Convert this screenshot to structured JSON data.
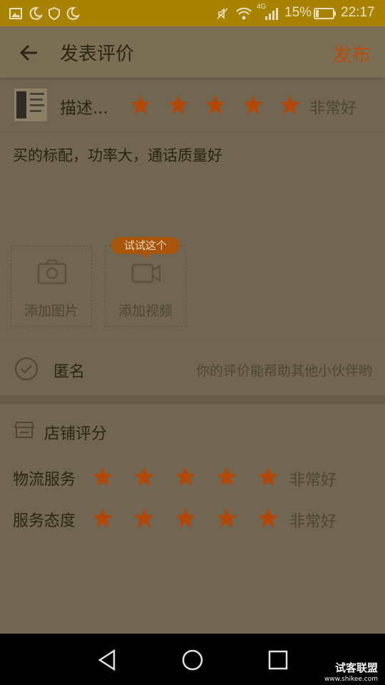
{
  "status_bar": {
    "network": "4G",
    "battery": "15%",
    "time": "22:17"
  },
  "app_bar": {
    "title": "发表评价",
    "publish_label": "发布"
  },
  "product_rating": {
    "label": "描述...",
    "stars": 5,
    "max_stars": 5,
    "rating_text": "非常好"
  },
  "review": {
    "text": "买的标配，功率大，通话质量好"
  },
  "media": {
    "add_photo_label": "添加图片",
    "add_video_label": "添加视频",
    "video_tip": "试试这个"
  },
  "anonymous": {
    "label": "匿名",
    "hint": "你的评价能帮助其他小伙伴哟"
  },
  "shop": {
    "title": "店铺评分",
    "ratings": [
      {
        "label": "物流服务",
        "stars": 5,
        "max_stars": 5,
        "rating_text": "非常好"
      },
      {
        "label": "服务态度",
        "stars": 5,
        "max_stars": 5,
        "rating_text": "非常好"
      }
    ]
  },
  "watermark": {
    "name": "试客联盟",
    "url": "www.shikee.com"
  },
  "colors": {
    "accent": "#b94d09",
    "star": "#b34708",
    "status_bar": "#a88300"
  },
  "icons": [
    "back-arrow-icon",
    "camera-icon",
    "video-camera-icon",
    "check-circle-icon",
    "store-icon",
    "nav-back-icon",
    "nav-home-icon",
    "nav-recents-icon"
  ]
}
